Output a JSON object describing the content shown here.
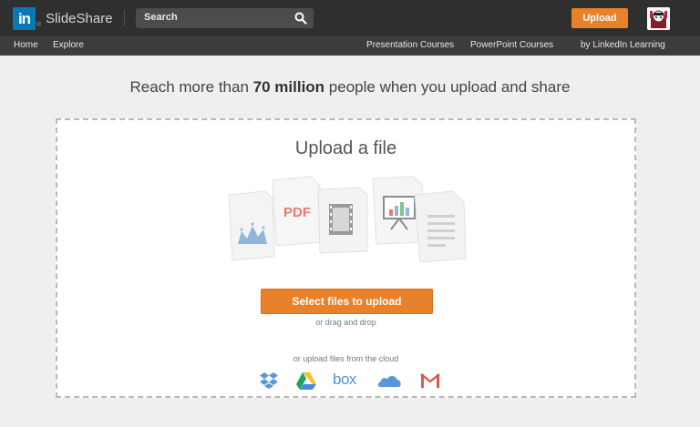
{
  "header": {
    "brand": "SlideShare",
    "linkedin_mark": "in",
    "search_placeholder": "Search",
    "upload_label": "Upload"
  },
  "subnav": {
    "left": [
      "Home",
      "Explore"
    ],
    "right": [
      "Presentation Courses",
      "PowerPoint Courses",
      "by LinkedIn Learning"
    ]
  },
  "main": {
    "headline_pre": "Reach more than ",
    "headline_bold": "70 million",
    "headline_post": " people when you upload and share",
    "upload_title": "Upload a file",
    "pdf_label": "PDF",
    "select_button": "Select files to upload",
    "drag_text": "or drag and drop",
    "cloud_text": "or upload files from the cloud",
    "cloud_services": [
      "dropbox-icon",
      "google-drive-icon",
      "box-icon",
      "onedrive-icon",
      "gmail-icon"
    ],
    "box_label": "box"
  },
  "colors": {
    "accent": "#e9812a",
    "topbar": "#2f2f2f",
    "subnav": "#3c3c3c",
    "linkedin": "#0b77b5"
  }
}
